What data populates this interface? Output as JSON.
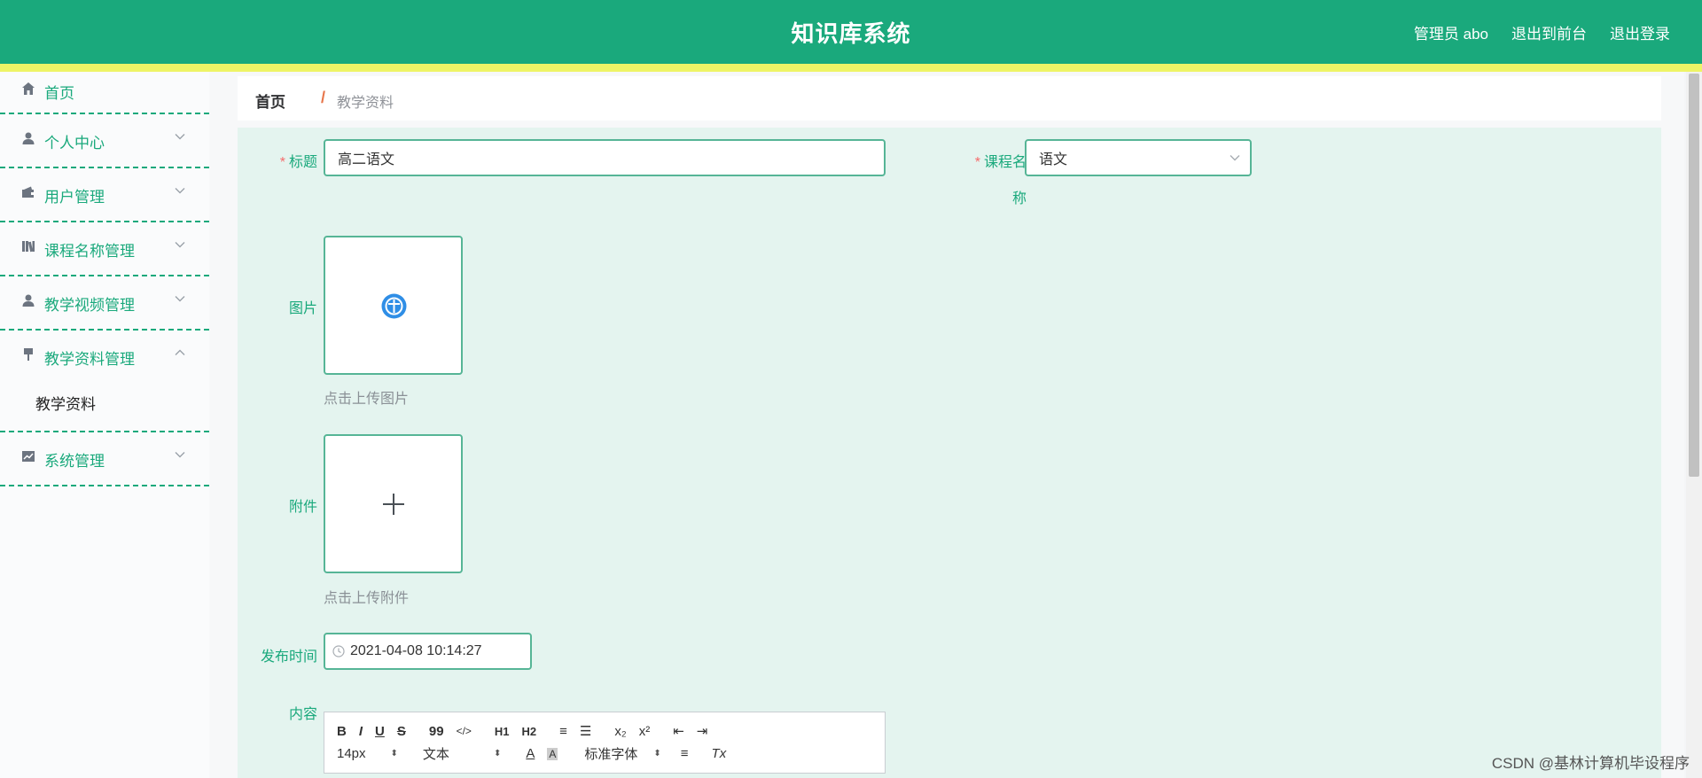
{
  "header": {
    "title": "知识库系统",
    "links": [
      "管理员 abo",
      "退出到前台",
      "退出登录"
    ]
  },
  "sidebar": {
    "items": [
      {
        "label": "首页",
        "icon": "home-icon"
      },
      {
        "label": "个人中心",
        "icon": "user-icon"
      },
      {
        "label": "用户管理",
        "icon": "wallet-icon"
      },
      {
        "label": "课程名称管理",
        "icon": "books-icon"
      },
      {
        "label": "教学视频管理",
        "icon": "user-icon"
      },
      {
        "label": "教学资料管理",
        "icon": "pin-icon",
        "sub": "教学资料"
      },
      {
        "label": "系统管理",
        "icon": "chart-icon"
      }
    ]
  },
  "breadcrumb": {
    "home": "首页",
    "separator": "/",
    "current": "教学资料"
  },
  "form": {
    "title_label": "标题",
    "title_value": "高二语文",
    "course_label_1": "课程名",
    "course_label_2": "称",
    "course_value": "语文",
    "image_label": "图片",
    "image_hint": "点击上传图片",
    "attachment_label": "附件",
    "attachment_hint": "点击上传附件",
    "time_label": "发布时间",
    "time_value": "2021-04-08 10:14:27",
    "content_label": "内容"
  },
  "editor": {
    "row1": [
      "B",
      "I",
      "U",
      "S",
      "99",
      "</>",
      "H1",
      "H2",
      "≡",
      "☰",
      "x₂",
      "x²",
      "⇤",
      "⇥"
    ],
    "font_size": "14px",
    "text_style": "文本",
    "font_family": "标准字体",
    "row2_extra": [
      "A",
      "A",
      "≡",
      "Tx"
    ]
  },
  "watermark": "CSDN @基林计算机毕设程序",
  "colors": {
    "primary": "#1aa97c",
    "stripe": "#eef466",
    "panel": "#e4f4ef"
  }
}
